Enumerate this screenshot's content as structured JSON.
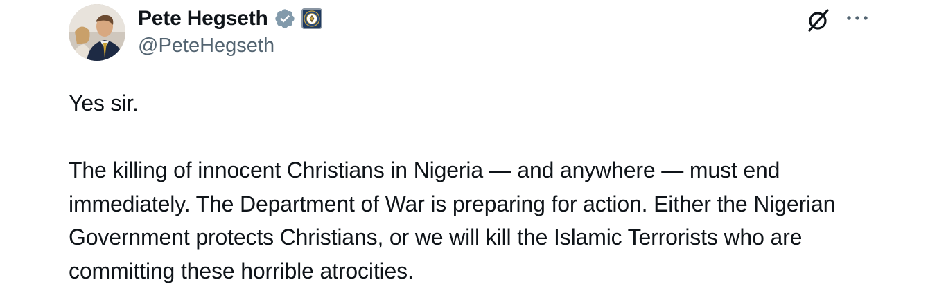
{
  "author": {
    "display_name": "Pete Hegseth",
    "handle": "@PeteHegseth",
    "verified": true,
    "affiliate_badge": "department-seal-icon"
  },
  "actions": {
    "grok_icon": "grok-icon",
    "more_icon": "more-horizontal-icon"
  },
  "tweet": {
    "paragraphs": [
      "Yes sir.",
      "The killing of innocent Christians in Nigeria — and anywhere — must end immediately. The Department of War is preparing for action. Either the Nigerian Government protects Christians, or we will kill the Islamic Terrorists who are committing these horrible atrocities."
    ]
  },
  "colors": {
    "text": "#0f1419",
    "secondary": "#536471",
    "verified_badge": "#829aab"
  }
}
